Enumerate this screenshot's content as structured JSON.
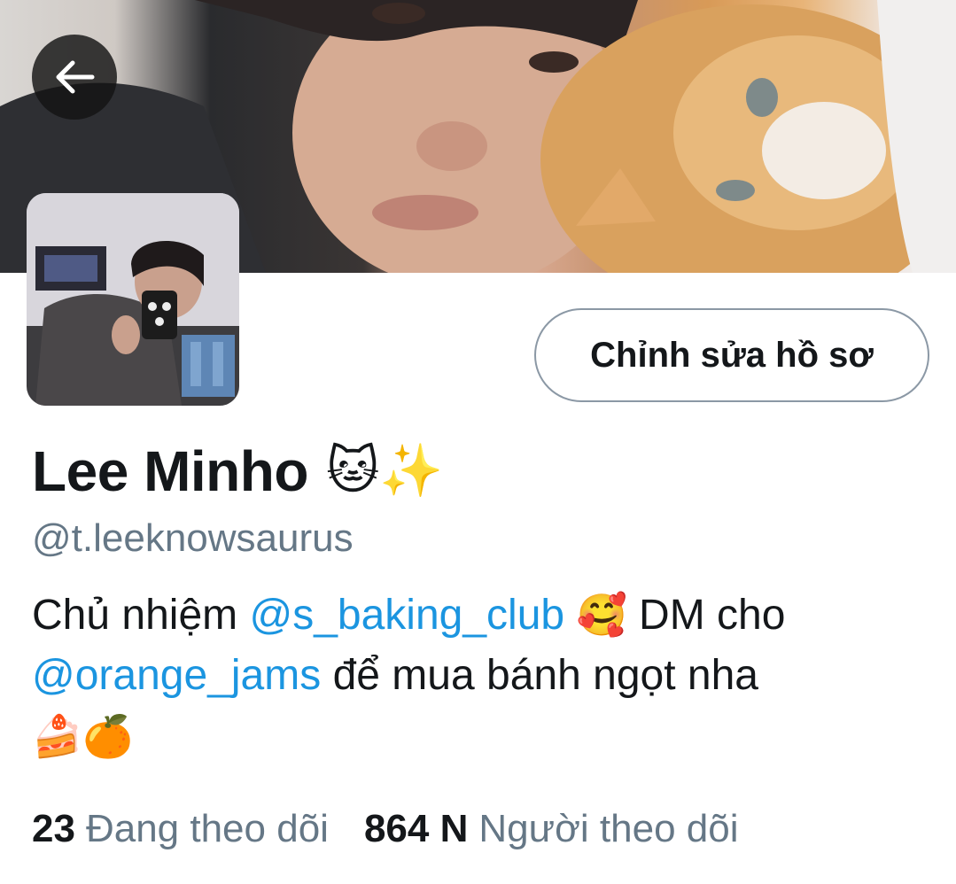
{
  "profile": {
    "display_name": "Lee Minho",
    "name_emojis": "🐱✨",
    "handle": "@t.leeknowsaurus",
    "edit_button_label": "Chỉnh sửa hồ sơ",
    "bio": {
      "part1": "Chủ nhiệm ",
      "mention1": "@s_baking_club",
      "emoji1": "🥰",
      "part2": " DM cho ",
      "mention2": "@orange_jams",
      "part3": " để mua bánh ngọt nha",
      "emoji2": "🍰🍊"
    },
    "stats": {
      "following_count": "23",
      "following_label": "Đang theo dõi",
      "followers_count": "864 N",
      "followers_label": "Người theo dõi"
    }
  },
  "icons": {
    "back": "arrow-left-icon"
  },
  "colors": {
    "link": "#1b95e0",
    "secondary_text": "#657786",
    "button_border": "#8b98a5"
  }
}
